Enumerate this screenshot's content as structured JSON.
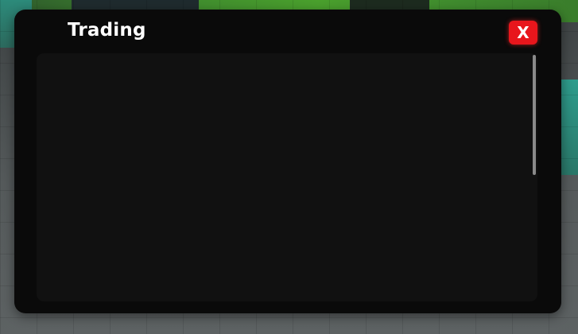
{
  "window": {
    "title": "Trading",
    "close_label": "X"
  },
  "scroll": {
    "thumb_fraction": 0.49,
    "position": 0
  },
  "colors": {
    "window_bg": "#0a0a0a",
    "panel_bg": "#111111",
    "close_button": "#e8161c",
    "title_text": "#ffffff",
    "scrollbar_thumb": "#8a8a8a"
  },
  "icons": {
    "close": "close-icon"
  }
}
